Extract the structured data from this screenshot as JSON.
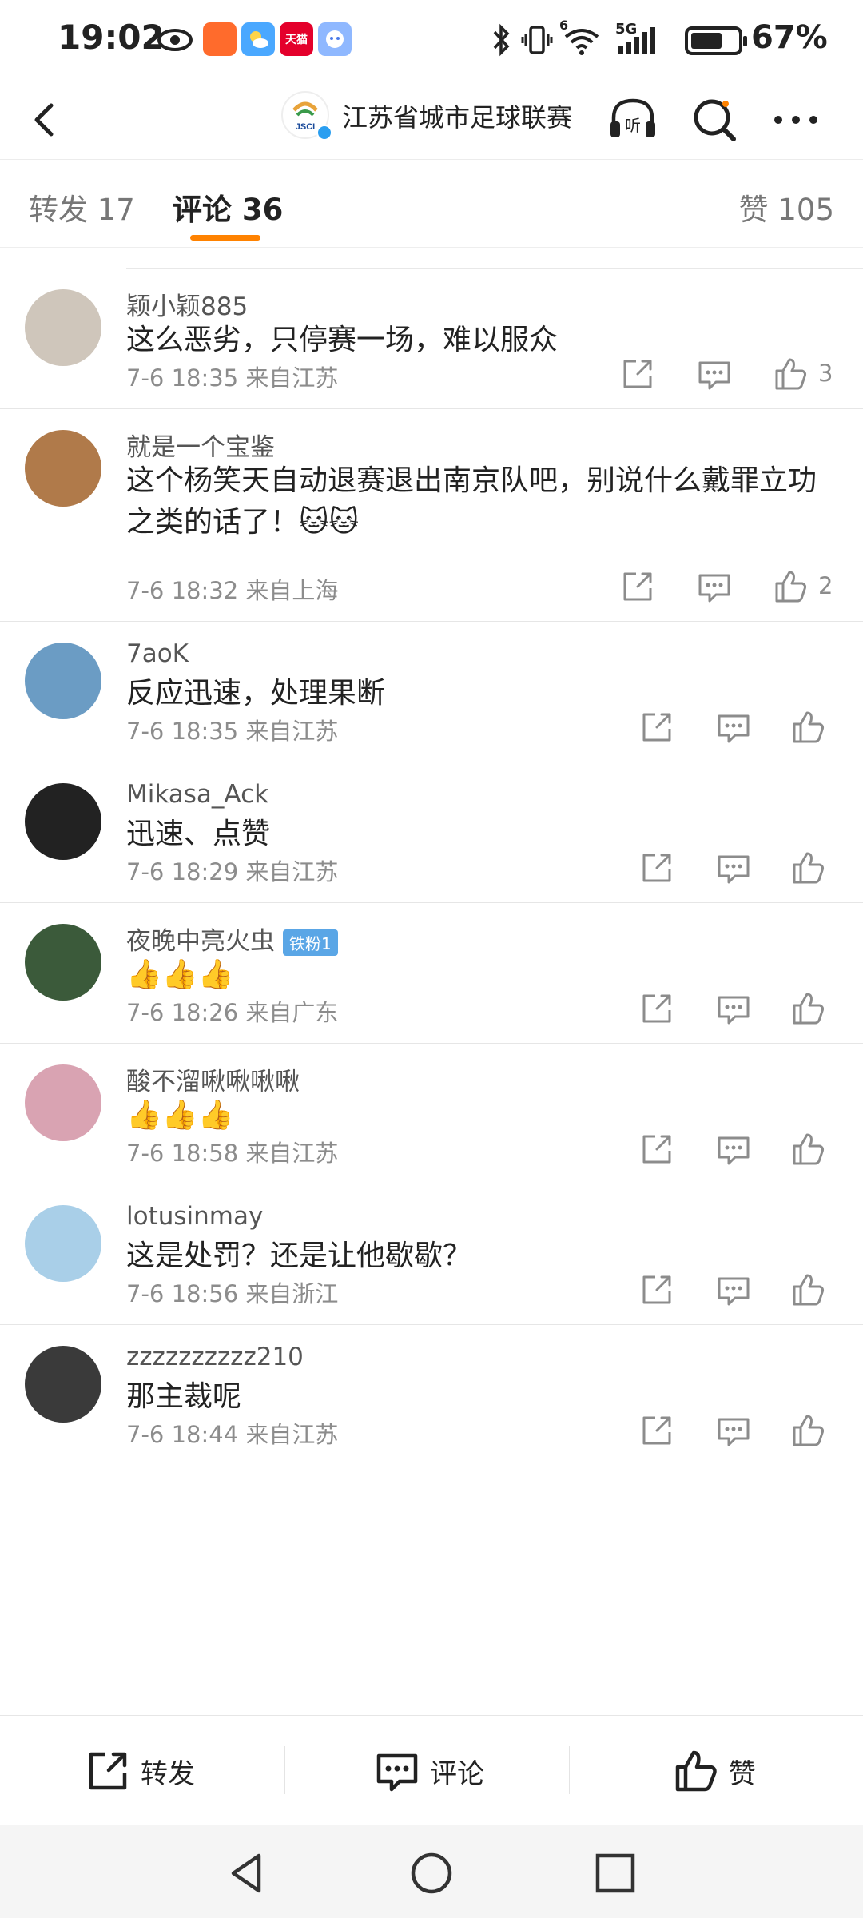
{
  "status": {
    "time": "19:02",
    "battery": "67%",
    "battery_level": 0.67,
    "network": "5G",
    "signal_sub": "6",
    "apps": [
      {
        "name": "app-icon-1",
        "label": "",
        "color": "#ff6b2c"
      },
      {
        "name": "weather-app-icon",
        "label": "",
        "color": "#4aa8ff"
      },
      {
        "name": "tmall-app-icon",
        "label": "天猫",
        "color": "#e4002b"
      },
      {
        "name": "assistant-app-icon",
        "label": "",
        "color": "#8fb8ff"
      }
    ]
  },
  "nav": {
    "title": "江苏省城市足球联赛",
    "avatar_text": "JSCI"
  },
  "tabs": {
    "repost": "转发 17",
    "comments": "评论 36",
    "likes": "赞 105"
  },
  "comments": [
    {
      "user": "颖小颖885",
      "text": "这么恶劣，只停赛一场，难以服众",
      "time": "7-6 18:35",
      "loc": "来自江苏",
      "likes": "3",
      "avatar": "#cfc6bb"
    },
    {
      "user": "就是一个宝鉴",
      "text": "这个杨笑天自动退赛退出南京队吧，别说什么戴罪立功之类的话了！🐱🐱",
      "time": "7-6 18:32",
      "loc": "来自上海",
      "likes": "2",
      "avatar": "#b07a4a"
    },
    {
      "user": "7aoK",
      "text": "反应迅速，处理果断",
      "time": "7-6 18:35",
      "loc": "来自江苏",
      "likes": "",
      "avatar": "#6b9cc4"
    },
    {
      "user": "Mikasa_Ack",
      "text": "迅速、点赞",
      "time": "7-6 18:29",
      "loc": "来自江苏",
      "likes": "",
      "avatar": "#222222"
    },
    {
      "user": "夜晚中亮火虫",
      "badge": "铁粉1",
      "text": "👍👍👍",
      "time": "7-6 18:26",
      "loc": "来自广东",
      "likes": "",
      "avatar": "#3b5a3a"
    },
    {
      "user": "酸不溜啾啾啾啾",
      "text": "👍👍👍",
      "time": "7-6 18:58",
      "loc": "来自江苏",
      "likes": "",
      "avatar": "#d9a3b2"
    },
    {
      "user": "lotusinmay",
      "text": "这是处罚？还是让他歇歇？",
      "time": "7-6 18:56",
      "loc": "来自浙江",
      "likes": "",
      "avatar": "#a9cfe8"
    },
    {
      "user": "zzzzzzzzzz210",
      "text": "那主裁呢",
      "time": "7-6 18:44",
      "loc": "来自江苏",
      "likes": "",
      "avatar": "#3a3a3a"
    }
  ],
  "bottom": {
    "repost": "转发",
    "comment": "评论",
    "like": "赞"
  },
  "colors": {
    "accent": "#ff8200",
    "verified": "#2a9ef0"
  }
}
